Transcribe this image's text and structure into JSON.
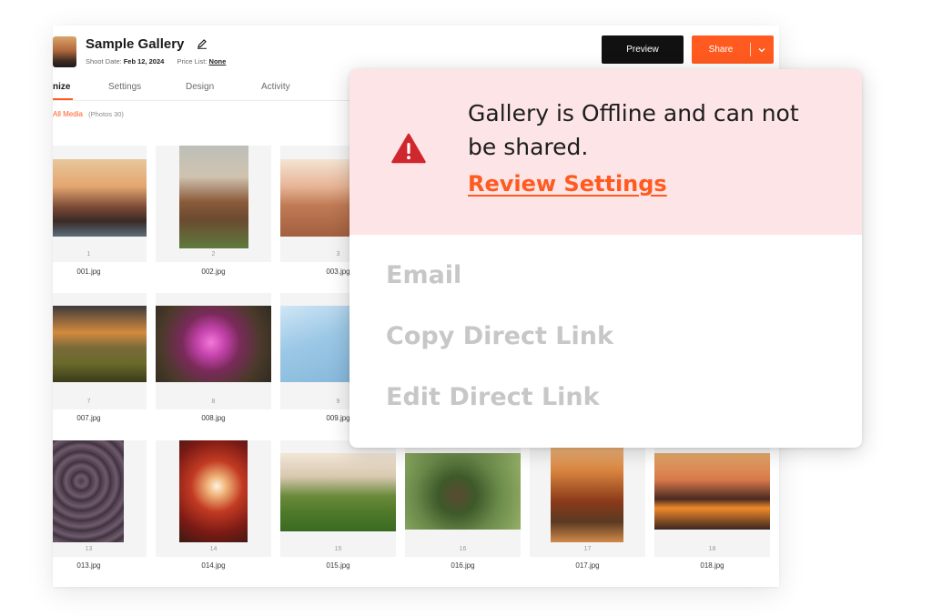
{
  "header": {
    "title": "Sample Gallery",
    "shoot_date_label": "Shoot Date:",
    "shoot_date": "Feb 12, 2024",
    "price_list_label": "Price List:",
    "price_list": "None",
    "preview_label": "Preview",
    "share_label": "Share"
  },
  "tabs": [
    {
      "label": "nize",
      "active": true
    },
    {
      "label": "Settings"
    },
    {
      "label": "Design"
    },
    {
      "label": "Activity"
    }
  ],
  "filter": {
    "label": "All Media",
    "count": "(Photos 30)"
  },
  "photos": [
    {
      "num": "1",
      "file": "001.jpg"
    },
    {
      "num": "2",
      "file": "002.jpg"
    },
    {
      "num": "3",
      "file": "003.jpg"
    },
    {
      "num": "7",
      "file": "007.jpg"
    },
    {
      "num": "8",
      "file": "008.jpg"
    },
    {
      "num": "9",
      "file": "009.jpg"
    },
    {
      "num": "13",
      "file": "013.jpg"
    },
    {
      "num": "14",
      "file": "014.jpg"
    },
    {
      "num": "15",
      "file": "015.jpg"
    },
    {
      "num": "16",
      "file": "016.jpg"
    },
    {
      "num": "17",
      "file": "017.jpg"
    },
    {
      "num": "18",
      "file": "018.jpg"
    }
  ],
  "popup": {
    "alert_line1": "Gallery is Offline and can not",
    "alert_line2": "be shared.",
    "review_link": "Review Settings",
    "menu": [
      "Email",
      "Copy Direct Link",
      "Edit Direct Link"
    ]
  },
  "colors": {
    "accent": "#ff5a1f",
    "alert_bg": "#fde4e6",
    "warning_icon": "#d0262d",
    "disabled_text": "#c7c7c7"
  }
}
